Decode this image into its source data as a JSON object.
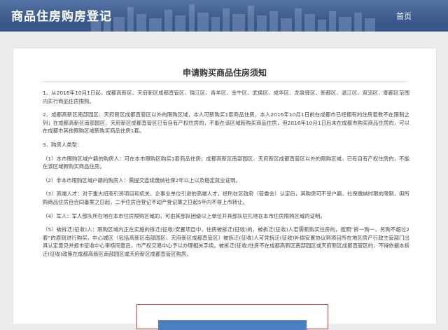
{
  "header": {
    "site_title": "商品住房购房登记",
    "home_link": "首页"
  },
  "notice": {
    "title": "申请购买商品住房须知",
    "paragraphs": [
      "1、从2016年10月1日起，成都高新区、天府新区成都直管区、锦江区、青羊区、金牛区、武侯区、成华区、龙泉驿区、新都区、温江区、双流区、郫都区范围内实行商品住房限购。",
      "2、成都高新区南部园区、天府新区成都直管区以外的限购区域，本人可新购买1套商品住房，本人2016年10月1日前在成都市已经拥有的住房套数不在限制之列；在成都高新区南部园区、天府新区成都直管区已有自有产权住房的，不能在该区域新购买商品住房，但2016年10月1日后未在成都市购买商品住房的，可以在成都市其他限购区域新购买商品住房1套。",
      "3、购房人类型：",
      "（1）本市限购区域户籍的购房人：可在本市限购区购买1套商品住房；成都高新区南部园区、天府新区成都直管区以外的限购区域，已有自有产权住房的，不能在该区域新购买商品住房。",
      "（2）非本市限购区域户籍的购房人：需提交连续缴纳社保2年以上以及稳定就业证明。",
      "（3）高端人才：对于重大招商引资项目和机关、企事业单位引进的高端人才，经所在区政府（管委会）认定后，其购房可不受户籍、社保缴纳时限的限制，但所购商品住房自合同备案之日起，二手住房自登记不动产登记簿之日起5年内不得上市转让。",
      "（4）军人：军人部队所在地在本市住房限购区域的，可由其部队团级以上单位开具部队驻扎地在本市住房限购区域的证明。",
      "（5）被拆迁(征收)人：限购区域内正在实施的拆迁(征收)安置项目中，住房被拆迁(征收)的，被拆迁(征收)人若需新购买住房的，按照“拆一购一，另购不超过2套”的原则进行购买。中心城区（包括高新区南部园区、天府新区成都直管区）被拆迁(征收)人可凭拆迁(征收)补偿安置协议到项目所在地区房产行政主管部门出具认定意见并报市征收中心审核同意后，市产权交易中心予以办理相关手续。被拆迁(征收)住房不在成都高新区南部园区或天府新区成都直管区的，不得依据本拆迁(征收)政策在成都高新区南部园区或天府新区成都直管区购房。"
    ]
  },
  "colors": {
    "header_bg": "#3c5a8c",
    "highlight_border": "#d93a3a",
    "button_bg": "#4a7fc1"
  }
}
